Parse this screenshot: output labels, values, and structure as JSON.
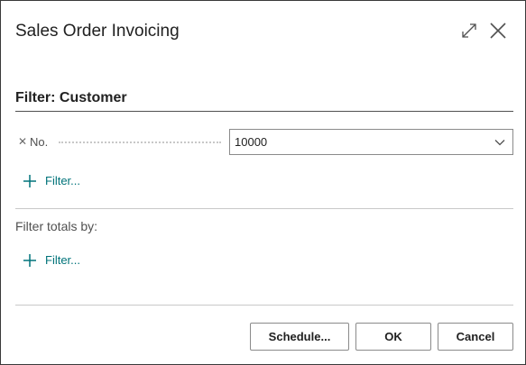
{
  "dialog": {
    "title": "Sales Order Invoicing",
    "expand_icon": "expand-diagonal-icon",
    "close_icon": "close-icon"
  },
  "filter_section": {
    "heading": "Filter: Customer",
    "fields": [
      {
        "label": "No.",
        "value": "10000",
        "remove_icon": "remove-x-icon",
        "dropdown_icon": "chevron-down-icon"
      }
    ],
    "add_filter_label": "Filter..."
  },
  "totals_section": {
    "label": "Filter totals by:",
    "add_filter_label": "Filter..."
  },
  "buttons": {
    "schedule": "Schedule...",
    "ok": "OK",
    "cancel": "Cancel"
  },
  "colors": {
    "accent": "#00737a",
    "border": "#8a8a8a",
    "text": "#212121"
  }
}
